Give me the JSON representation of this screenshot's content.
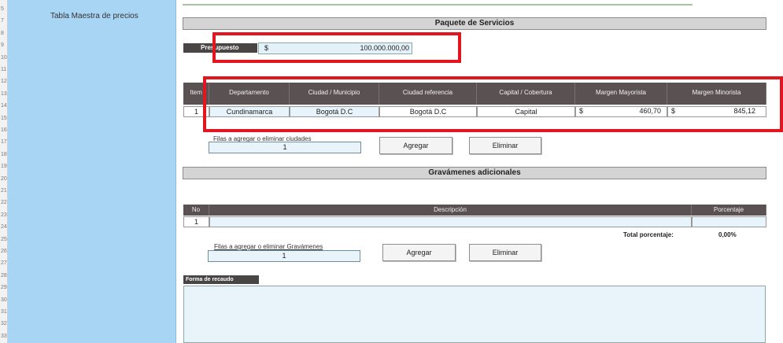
{
  "sidebar": {
    "title": "Tabla Maestra de precios"
  },
  "row_numbers": [
    "5",
    "7",
    "8",
    "9",
    "10",
    "11",
    "12",
    "13",
    "14",
    "15",
    "16",
    "17",
    "18",
    "19",
    "20",
    "21",
    "22",
    "23",
    "24",
    "25",
    "26",
    "27",
    "28",
    "29",
    "30",
    "31",
    "32",
    "33"
  ],
  "paquete": {
    "title": "Paquete de Servicios",
    "presupuesto_label": "Presupuesto",
    "currency": "$",
    "presupuesto_value": "100.000.000,00"
  },
  "cities_table": {
    "columns": [
      "Item",
      "Departamento",
      "Ciudad / Municipio",
      "Ciudad referencia",
      "Capital / Cobertura",
      "Margen Mayorista",
      "Margen Minorista"
    ],
    "row": {
      "item": "1",
      "departamento": "Cundinamarca",
      "ciudad": "Bogotá D.C",
      "referencia": "Bogotá D.C",
      "cobertura": "Capital",
      "mayorista_cur": "$",
      "mayorista": "460,70",
      "minorista_cur": "$",
      "minorista": "845,12"
    }
  },
  "cities_controls": {
    "rows_label": "Filas a agregar o eliminar ciudades",
    "rows_value": "1",
    "add": "Agregar",
    "remove": "Eliminar"
  },
  "gravamenes": {
    "title": "Gravámenes adicionales",
    "columns": [
      "No",
      "Descripción",
      "Porcentaje"
    ],
    "row_no": "1",
    "total_label": "Total porcentaje:",
    "total_value": "0,00%",
    "rows_label": "Filas a agregar o eliminar Gravámenes",
    "rows_value": "1",
    "add": "Agregar",
    "remove": "Eliminar"
  },
  "recaudo": {
    "label": "Forma de recaudo"
  },
  "colors": {
    "sidebar": "#a9d5f5",
    "header_dark": "#5a5252",
    "highlight": "#e3161f"
  }
}
